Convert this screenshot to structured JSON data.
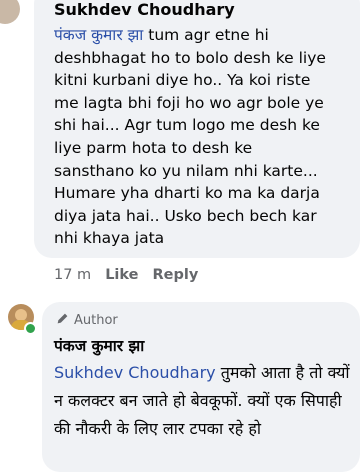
{
  "comment1": {
    "author": "Sukhdev Choudhary",
    "mention": "पंकज कुमार झा",
    "text": " tum agr etne hi\ndeshbhagat ho to bolo desh ke liye\nkitni kurbani diye ho.. Ya koi riste\nme lagta bhi foji ho wo agr bole ye\nshi hai... Agr tum logo me desh ke\nliye parm hota to desh ke\nsansthano ko yu nilam nhi karte...\nHumare yha dharti ko ma ka darja\ndiya jata hai.. Usko bech bech kar\nnhi khaya jata",
    "time": "17 m",
    "like_label": "Like",
    "reply_label": "Reply"
  },
  "comment2": {
    "badge": "Author",
    "author": "पंकज कुमार झा",
    "mention": "Sukhdev Choudhary",
    "text": " तुमको आता है तो क्यों न कलक्टर बन जाते हो बेवकूफों. क्यों एक सिपाही की नौकरी के लिए लार टपका रहे हो"
  },
  "colors": {
    "bubble": "#f0f2f5",
    "mention": "#2b4fa8",
    "meta": "#65676b",
    "online": "#31a24c"
  }
}
